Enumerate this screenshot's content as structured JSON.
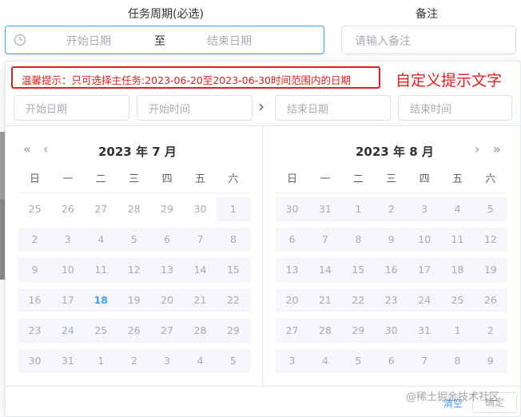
{
  "form": {
    "period_label": "任务周期(必选)",
    "note_label": "备注",
    "range_start_placeholder": "开始日期",
    "range_separator": "至",
    "range_end_placeholder": "结束日期",
    "note_placeholder": "请输入备注"
  },
  "picker": {
    "tip": "温馨提示：只可选择主任务:2023-06-20至2023-06-30时间范围内的日期",
    "custom_note": "自定义提示文字",
    "start_date_placeholder": "开始日期",
    "start_time_placeholder": "开始时间",
    "arrow": "›",
    "end_date_placeholder": "结束日期",
    "end_time_placeholder": "结束时间",
    "left_title": "2023 年 7 月",
    "right_title": "2023 年 8 月",
    "nav_prev_year": "«",
    "nav_prev_month": "‹",
    "nav_next_month": "›",
    "nav_next_year": "»",
    "weekdays": [
      "日",
      "一",
      "二",
      "三",
      "四",
      "五",
      "六"
    ],
    "left_weeks": [
      [
        "25",
        "26",
        "27",
        "28",
        "29",
        "30",
        "1"
      ],
      [
        "2",
        "3",
        "4",
        "5",
        "6",
        "7",
        "8"
      ],
      [
        "9",
        "10",
        "11",
        "12",
        "13",
        "14",
        "15"
      ],
      [
        "16",
        "17",
        "18",
        "19",
        "20",
        "21",
        "22"
      ],
      [
        "23",
        "24",
        "25",
        "26",
        "27",
        "28",
        "29"
      ],
      [
        "30",
        "31",
        "1",
        "2",
        "3",
        "4",
        "5"
      ]
    ],
    "right_weeks": [
      [
        "30",
        "31",
        "1",
        "2",
        "3",
        "4",
        "5"
      ],
      [
        "6",
        "7",
        "8",
        "9",
        "10",
        "11",
        "12"
      ],
      [
        "13",
        "14",
        "15",
        "16",
        "17",
        "18",
        "19"
      ],
      [
        "20",
        "21",
        "22",
        "23",
        "24",
        "25",
        "26"
      ],
      [
        "27",
        "28",
        "29",
        "30",
        "31",
        "1",
        "2"
      ],
      [
        "3",
        "4",
        "5",
        "6",
        "7",
        "8",
        "9"
      ]
    ],
    "today": "18",
    "clear_label": "清空",
    "ok_label": "确定"
  },
  "watermark": "@稀土掘金技术社区",
  "colors": {
    "accent": "#409eff",
    "tip_red": "#e02020",
    "disabled_bg": "#f5f7fa"
  }
}
